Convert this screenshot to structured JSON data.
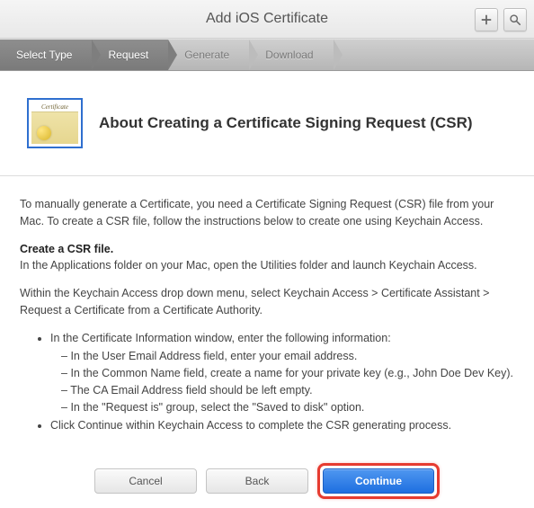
{
  "header": {
    "title": "Add iOS Certificate",
    "actions": {
      "add": "+",
      "search": "search"
    }
  },
  "steps": [
    {
      "label": "Select Type",
      "state": "active"
    },
    {
      "label": "Request",
      "state": "active"
    },
    {
      "label": "Generate",
      "state": "inactive"
    },
    {
      "label": "Download",
      "state": "inactive"
    }
  ],
  "page": {
    "heading": "About Creating a Certificate Signing Request (CSR)",
    "icon_label": "Certificate",
    "intro": "To manually generate a Certificate, you need a Certificate Signing Request (CSR) file from your Mac. To create a CSR file, follow the instructions below to create one using Keychain Access.",
    "section_label": "Create a CSR file.",
    "step1": "In the Applications folder on your Mac, open the Utilities folder and launch Keychain Access.",
    "step2": "Within the Keychain Access drop down menu, select Keychain Access > Certificate Assistant > Request a Certificate from a Certificate Authority.",
    "bullets": [
      {
        "text": "In the Certificate Information window, enter the following information:",
        "sub": [
          "In the User Email Address field, enter your email address.",
          "In the Common Name field, create a name for your private key (e.g., John Doe Dev Key).",
          "The CA Email Address field should be left empty.",
          "In the \"Request is\" group, select the \"Saved to disk\" option."
        ]
      },
      {
        "text": "Click Continue within Keychain Access to complete the CSR generating process."
      }
    ]
  },
  "footer": {
    "cancel": "Cancel",
    "back": "Back",
    "continue": "Continue"
  }
}
